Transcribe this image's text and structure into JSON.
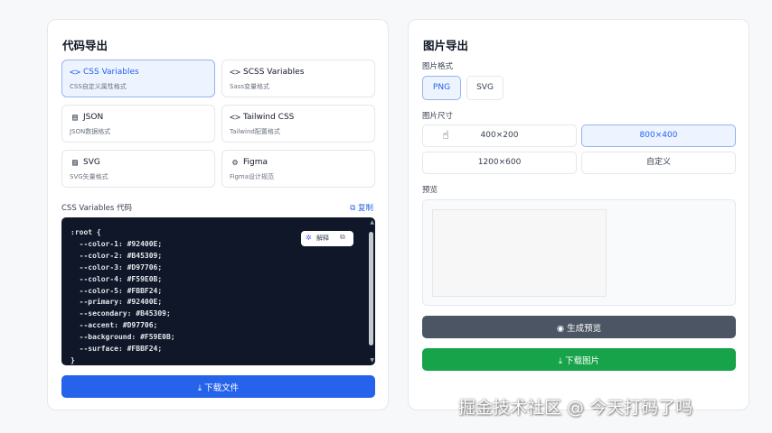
{
  "code_export": {
    "title": "代码导出",
    "formats": [
      {
        "icon": "code-icon",
        "glyph": "<>",
        "name": "CSS Variables",
        "desc": "CSS自定义属性格式",
        "active": true
      },
      {
        "icon": "code-icon",
        "glyph": "<>",
        "name": "SCSS Variables",
        "desc": "Sass变量格式",
        "active": false
      },
      {
        "icon": "file-icon",
        "glyph": "▤",
        "name": "JSON",
        "desc": "JSON数据格式",
        "active": false
      },
      {
        "icon": "code-icon",
        "glyph": "<>",
        "name": "Tailwind CSS",
        "desc": "Tailwind配置格式",
        "active": false
      },
      {
        "icon": "image-icon",
        "glyph": "▨",
        "name": "SVG",
        "desc": "SVG矢量格式",
        "active": false
      },
      {
        "icon": "gear-icon",
        "glyph": "⚙",
        "name": "Figma",
        "desc": "Figma设计规范",
        "active": false
      }
    ],
    "code_label": "CSS Variables 代码",
    "copy_label": "复制",
    "explain_label": "解释",
    "code": ":root {\n  --color-1: #92400E;\n  --color-2: #B45309;\n  --color-3: #D97706;\n  --color-4: #F59E0B;\n  --color-5: #FBBF24;\n  --primary: #92400E;\n  --secondary: #B45309;\n  --accent: #D97706;\n  --background: #F59E0B;\n  --surface: #FBBF24;\n}",
    "download_label": "下载文件"
  },
  "image_export": {
    "title": "图片导出",
    "format_label": "图片格式",
    "formats": [
      "PNG",
      "SVG"
    ],
    "selected_format": "PNG",
    "size_label": "图片尺寸",
    "sizes": [
      "400×200",
      "800×400",
      "1200×600",
      "自定义"
    ],
    "selected_size": "800×400",
    "preview_label": "预览",
    "generate_label": "生成预览",
    "download_label": "下载图片"
  },
  "watermark": "掘金技术社区 @ 今天打码了吗",
  "colors": {
    "primary_blue": "#2563eb",
    "green": "#16a34a",
    "gray_button": "#4b5563",
    "code_bg": "#0f1729"
  }
}
